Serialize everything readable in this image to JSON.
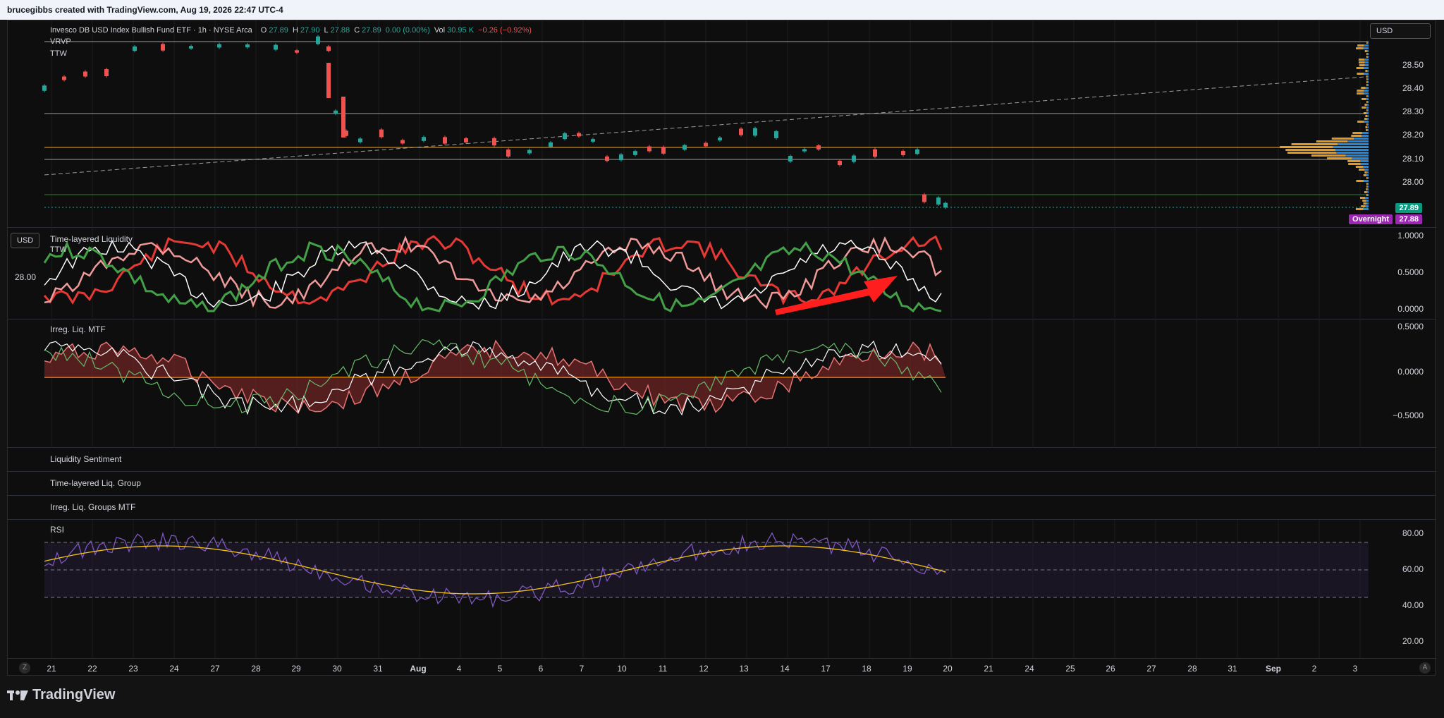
{
  "header": {
    "text": "brucegibbs created with TradingView.com, Aug 19, 2026 22:47 UTC-4"
  },
  "main": {
    "symbol": "Invesco DB USD Index Bullish Fund ETF · 1h · NYSE Arca",
    "ohlc": {
      "o_label": "O",
      "o": "27.89",
      "h_label": "H",
      "h": "27.90",
      "l_label": "L",
      "l": "27.88",
      "c_label": "C",
      "c": "27.89",
      "chg": "0.00 (0.00%)"
    },
    "vol_label": "Vol",
    "vol": "30.95 K",
    "vol_chg": "−0.26 (−0.92%)",
    "indicators": [
      "VRVP",
      "TTW"
    ],
    "currency": "USD",
    "price_ticks": [
      "28.50",
      "28.40",
      "28.30",
      "28.20",
      "28.10",
      "28.00"
    ],
    "last_price": "27.89",
    "overnight_label": "Overnight",
    "overnight_price": "27.88"
  },
  "pane_tll": {
    "title": "Time-layered Liquidity",
    "sub": "TTW",
    "currency": "USD",
    "left_value": "28.00",
    "ticks": [
      "1.0000",
      "0.5000",
      "0.0000"
    ]
  },
  "pane_irreg": {
    "title": "Irreg. Liq. MTF",
    "ticks": [
      "0.5000",
      "0.0000",
      "−0.5000"
    ]
  },
  "pane_sentiment": {
    "title": "Liquidity Sentiment"
  },
  "pane_tlg": {
    "title": "Time-layered Liq. Group"
  },
  "pane_ilg": {
    "title": "Irreg. Liq. Groups MTF"
  },
  "pane_rsi": {
    "title": "RSI",
    "ticks": [
      "80.00",
      "60.00",
      "40.00",
      "20.00"
    ]
  },
  "xaxis": {
    "ticks": [
      "21",
      "22",
      "23",
      "24",
      "27",
      "28",
      "29",
      "30",
      "31",
      "Aug",
      "4",
      "5",
      "6",
      "7",
      "10",
      "11",
      "12",
      "13",
      "14",
      "17",
      "18",
      "19",
      "20",
      "21",
      "24",
      "25",
      "26",
      "27",
      "28",
      "31",
      "Sep",
      "2",
      "3"
    ],
    "left_btn": "Z",
    "right_btn": "A"
  },
  "footer": {
    "brand": "TradingView"
  },
  "colors": {
    "up": "#26a69a",
    "down": "#ef5350",
    "rsi": "#7e57c2",
    "rsi_ma": "#f5c518",
    "overnight": "#9c27b0",
    "last": "#089981"
  }
}
